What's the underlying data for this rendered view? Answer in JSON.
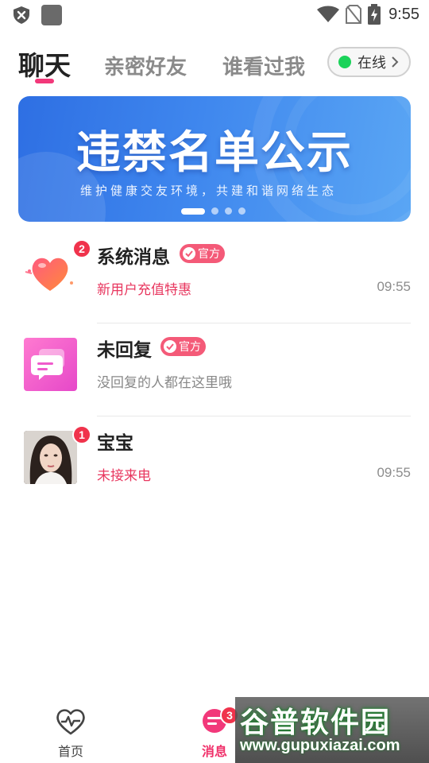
{
  "status_bar": {
    "time": "9:55",
    "icons": [
      "shield-icon",
      "app-square-icon",
      "wifi-icon",
      "no-sim-icon",
      "battery-charging-icon"
    ]
  },
  "tabs": [
    {
      "label": "聊天",
      "active": true
    },
    {
      "label": "亲密好友",
      "active": false
    },
    {
      "label": "谁看过我",
      "active": false
    }
  ],
  "online_status": {
    "label": "在线",
    "color": "#1bd35a"
  },
  "banner": {
    "title": "违禁名单公示",
    "subtitle": "维护健康交友环境，共建和谐网络生态",
    "page_count": 4,
    "active_page": 1
  },
  "chats": [
    {
      "name": "系统消息",
      "official_label": "官方",
      "subtitle": "新用户充值特惠",
      "subtitle_color": "red",
      "time": "09:55",
      "badge": "2",
      "avatar": "heart-icon"
    },
    {
      "name": "未回复",
      "official_label": "官方",
      "subtitle": "没回复的人都在这里哦",
      "subtitle_color": "gray",
      "time": "",
      "badge": "",
      "avatar": "message-bubble-icon"
    },
    {
      "name": "宝宝",
      "official_label": "",
      "subtitle": "未接来电",
      "subtitle_color": "red",
      "time": "09:55",
      "badge": "1",
      "avatar": "user-photo"
    }
  ],
  "bottom_nav": {
    "home_label": "首页",
    "messages_label": "消息",
    "messages_badge": "3"
  },
  "watermark": {
    "text": "谷普软件园",
    "url": "www.gupuxiazai.com"
  },
  "colors": {
    "accent": "#f2387a",
    "badge": "#f0334c",
    "official": "#f45a78",
    "banner": "#3f87ee"
  }
}
